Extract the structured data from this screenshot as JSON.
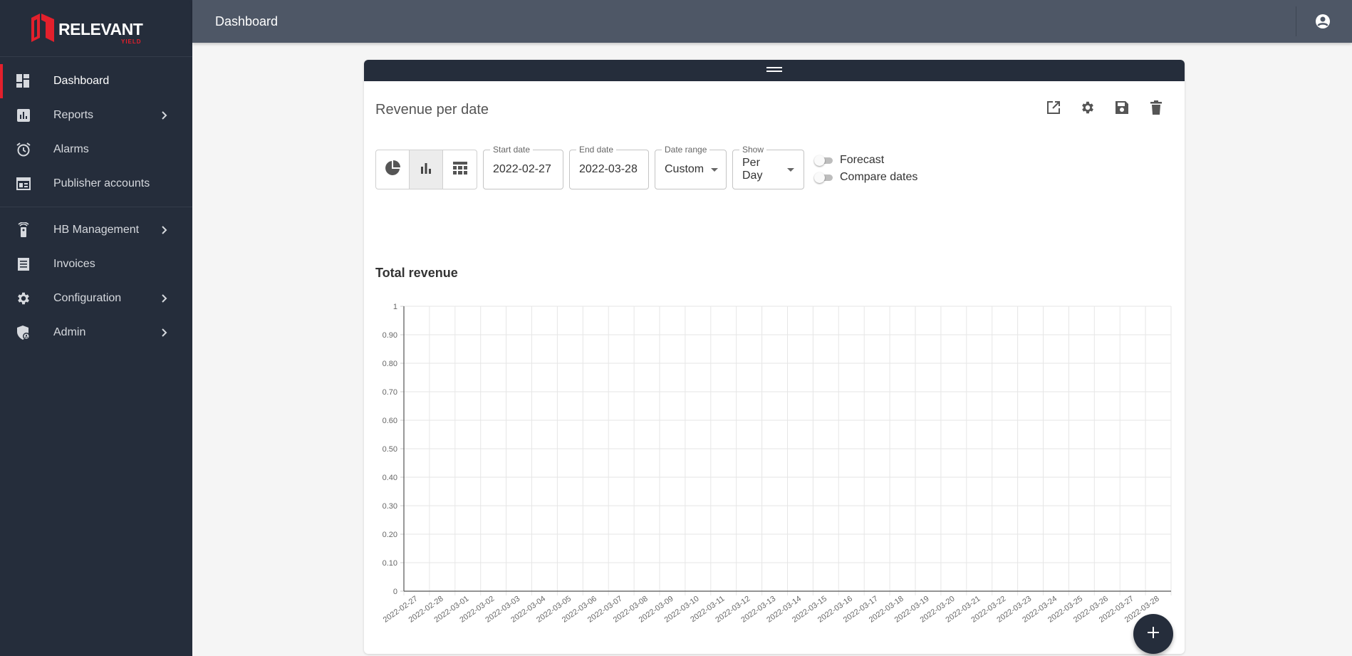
{
  "brand": {
    "name": "RELEVANT",
    "sub": "YIELD",
    "accent": "#e3202c"
  },
  "sidebar": {
    "items": [
      {
        "label": "Dashboard",
        "icon": "dashboard-icon",
        "active": true,
        "chevron": false
      },
      {
        "label": "Reports",
        "icon": "bar-chart-icon",
        "active": false,
        "chevron": true
      },
      {
        "label": "Alarms",
        "icon": "alarm-clock-icon",
        "active": false,
        "chevron": false
      },
      {
        "label": "Publisher accounts",
        "icon": "web-page-icon",
        "active": false,
        "chevron": false
      },
      {
        "label": "HB Management",
        "icon": "remote-icon",
        "active": false,
        "chevron": true
      },
      {
        "label": "Invoices",
        "icon": "receipt-icon",
        "active": false,
        "chevron": false
      },
      {
        "label": "Configuration",
        "icon": "gear-icon",
        "active": false,
        "chevron": true
      },
      {
        "label": "Admin",
        "icon": "admin-shield-icon",
        "active": false,
        "chevron": true
      }
    ]
  },
  "topbar": {
    "title": "Dashboard"
  },
  "widget": {
    "title": "Revenue per date",
    "start_date_label": "Start date",
    "start_date_value": "2022-02-27",
    "end_date_label": "End date",
    "end_date_value": "2022-03-28",
    "date_range_label": "Date range",
    "date_range_value": "Custom",
    "show_label": "Show",
    "show_value": "Per Day",
    "forecast_label": "Forecast",
    "compare_label": "Compare dates",
    "chart_title": "Total revenue"
  },
  "chart_data": {
    "type": "bar",
    "title": "Total revenue",
    "xlabel": "",
    "ylabel": "",
    "ylim": [
      0,
      1
    ],
    "yticks": [
      "0",
      "0.10",
      "0.20",
      "0.30",
      "0.40",
      "0.50",
      "0.60",
      "0.70",
      "0.80",
      "0.90",
      "1"
    ],
    "categories": [
      "2022-02-27",
      "2022-02-28",
      "2022-03-01",
      "2022-03-02",
      "2022-03-03",
      "2022-03-04",
      "2022-03-05",
      "2022-03-06",
      "2022-03-07",
      "2022-03-08",
      "2022-03-09",
      "2022-03-10",
      "2022-03-11",
      "2022-03-12",
      "2022-03-13",
      "2022-03-14",
      "2022-03-15",
      "2022-03-16",
      "2022-03-17",
      "2022-03-18",
      "2022-03-19",
      "2022-03-20",
      "2022-03-21",
      "2022-03-22",
      "2022-03-23",
      "2022-03-24",
      "2022-03-25",
      "2022-03-26",
      "2022-03-27",
      "2022-03-28"
    ],
    "values": [
      0,
      0,
      0,
      0,
      0,
      0,
      0,
      0,
      0,
      0,
      0,
      0,
      0,
      0,
      0,
      0,
      0,
      0,
      0,
      0,
      0,
      0,
      0,
      0,
      0,
      0,
      0,
      0,
      0,
      0
    ],
    "grid": true,
    "legend": "none"
  }
}
